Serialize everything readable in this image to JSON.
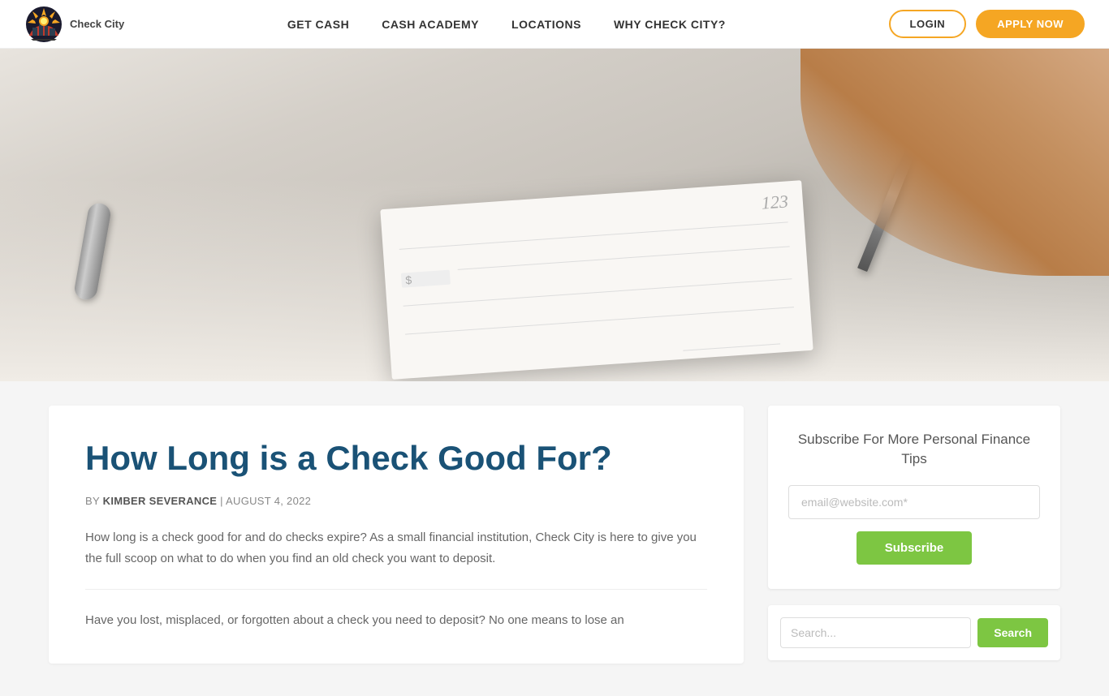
{
  "header": {
    "logo_text": "Check City",
    "nav_items": [
      {
        "label": "GET CASH",
        "id": "get-cash"
      },
      {
        "label": "CASH ACADEMY",
        "id": "cash-academy"
      },
      {
        "label": "LOCATIONS",
        "id": "locations"
      },
      {
        "label": "WHY CHECK CITY?",
        "id": "why-check-city"
      }
    ],
    "login_label": "LOGIN",
    "apply_label": "APPLY NOW"
  },
  "hero": {
    "alt": "Person writing a check with a pen"
  },
  "article": {
    "title": "How Long is a Check Good For?",
    "meta_by": "BY",
    "author": "KIMBER SEVERANCE",
    "separator": " | ",
    "date": "AUGUST 4, 2022",
    "intro": "How long is a check good for and do checks expire? As a small financial institution, Check City is here to give you the full scoop on what to do when you find an old check you want to deposit.",
    "body": "Have you lost, misplaced, or forgotten about a check you need to deposit? No one means to lose an"
  },
  "sidebar": {
    "subscribe": {
      "title": "Subscribe For More Personal Finance Tips",
      "email_placeholder": "email@website.com*",
      "button_label": "Subscribe"
    },
    "search": {
      "placeholder": "Search...",
      "button_label": "Search"
    }
  }
}
